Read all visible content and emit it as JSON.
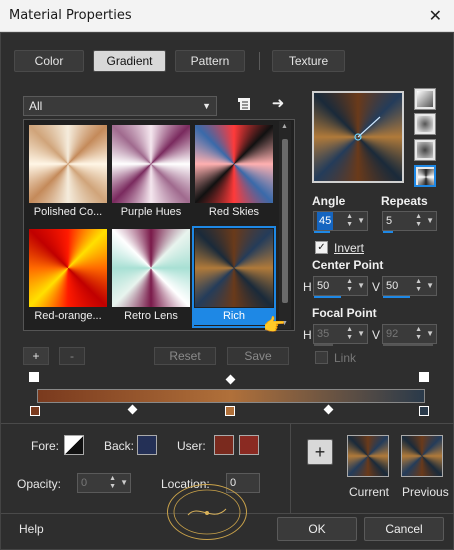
{
  "window": {
    "title": "Material Properties",
    "close_glyph": "✕"
  },
  "tabs": [
    {
      "label": "Color",
      "active": false
    },
    {
      "label": "Gradient",
      "active": true
    },
    {
      "label": "Pattern",
      "active": false
    },
    {
      "label": "Texture",
      "active": false
    }
  ],
  "category_dropdown": {
    "value": "All"
  },
  "gallery": {
    "items": [
      {
        "label": "Polished Co...",
        "colors": [
          "#f5ecdc",
          "#c48a5a",
          "#fff6e6",
          "#d0a47a"
        ]
      },
      {
        "label": "Purple Hues",
        "colors": [
          "#f4e6ee",
          "#7a2a5e",
          "#fff",
          "#a06a8e"
        ]
      },
      {
        "label": "Red Skies",
        "colors": [
          "#ff3a3a",
          "#111",
          "#ffb0b0",
          "#3a6aaa"
        ]
      },
      {
        "label": "Red-orange...",
        "colors": [
          "#ff1a00",
          "#ffe000",
          "#ff6a00",
          "#c00000"
        ]
      },
      {
        "label": "Retro Lens",
        "colors": [
          "#7a1a4a",
          "#e8f4ee",
          "#a8e0d4",
          "#fff"
        ]
      },
      {
        "label": "Rich",
        "colors": [
          "#6a3a1a",
          "#243c5a",
          "#b07a3a",
          "#1a2a3a"
        ],
        "selected": true
      }
    ]
  },
  "gallery_buttons": {
    "add": "+",
    "remove": "-",
    "reset": "Reset",
    "save": "Save"
  },
  "preview_colors": [
    "#6a3a1a",
    "#243c5a",
    "#b07a3a",
    "#1a2a3a"
  ],
  "angle": {
    "label": "Angle",
    "value": "45"
  },
  "repeats": {
    "label": "Repeats",
    "value": "5"
  },
  "invert": {
    "label": "Invert",
    "checked": true
  },
  "center_point": {
    "label": "Center Point",
    "h_label": "H",
    "h_value": "50",
    "v_label": "V",
    "v_value": "50"
  },
  "focal_point": {
    "label": "Focal Point",
    "h_label": "H",
    "h_value": "35",
    "v_label": "V",
    "v_value": "92"
  },
  "link": {
    "label": "Link",
    "checked": false
  },
  "gradient_strip": {
    "stops": [
      "#7a3a1e",
      "#b0703a",
      "#2a3a4a"
    ]
  },
  "fore": {
    "label": "Fore:"
  },
  "back": {
    "label": "Back:",
    "color": "#243056"
  },
  "user": {
    "label": "User:",
    "color1": "#7a2a1e",
    "color2": "#8a2a22"
  },
  "opacity": {
    "label": "Opacity:",
    "value": "0"
  },
  "location": {
    "label": "Location:",
    "value": "0"
  },
  "add_button": "+",
  "current": {
    "label": "Current"
  },
  "previous": {
    "label": "Previous"
  },
  "help": "Help",
  "ok": "OK",
  "cancel": "Cancel"
}
